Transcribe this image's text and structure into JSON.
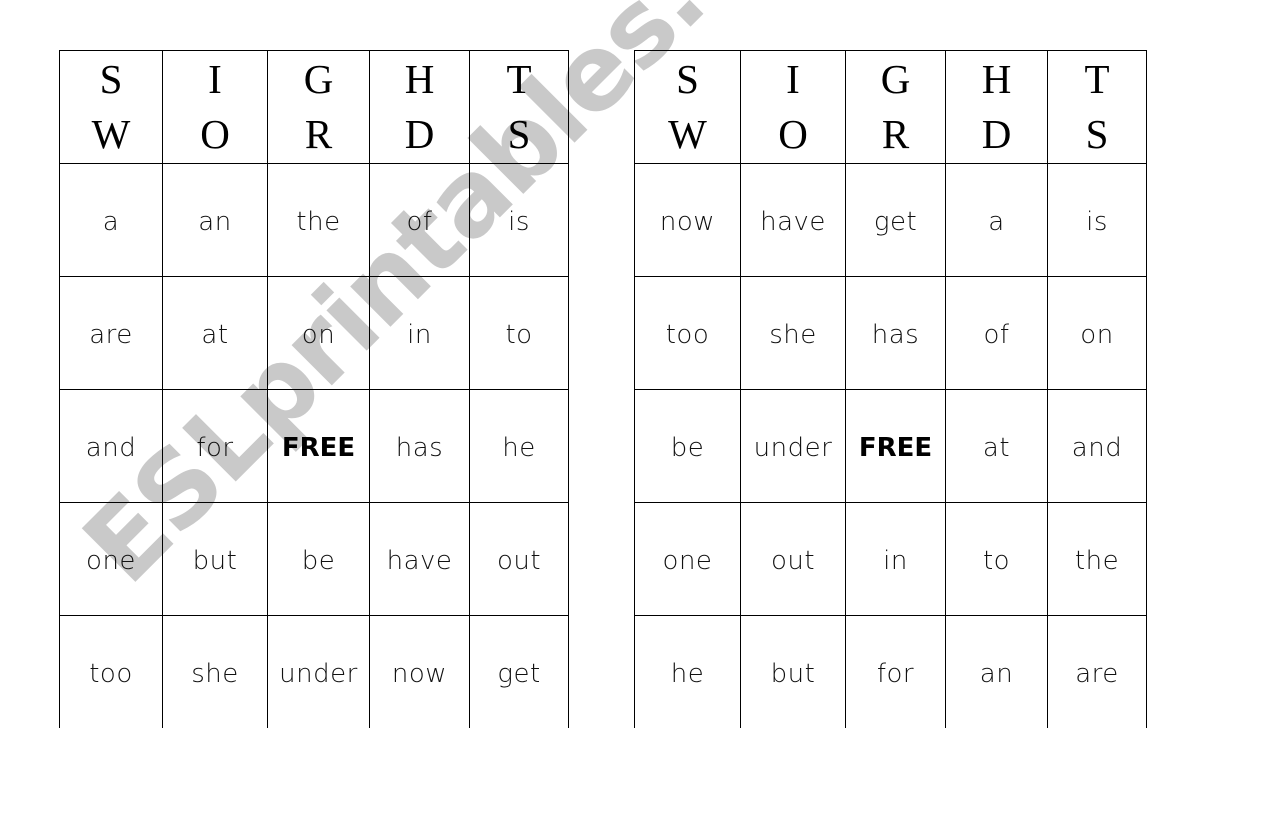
{
  "watermark": "ESLprintables.com",
  "header": {
    "top": [
      "S",
      "I",
      "G",
      "H",
      "T"
    ],
    "bottom": [
      "W",
      "O",
      "R",
      "D",
      "S"
    ]
  },
  "boards": [
    {
      "rows": [
        [
          "a",
          "an",
          "the",
          "of",
          "is"
        ],
        [
          "are",
          "at",
          "on",
          "in",
          "to"
        ],
        [
          "and",
          "for",
          "FREE",
          "has",
          "he"
        ],
        [
          "one",
          "but",
          "be",
          "have",
          "out"
        ],
        [
          "too",
          "she",
          "under",
          "now",
          "get"
        ]
      ]
    },
    {
      "rows": [
        [
          "now",
          "have",
          "get",
          "a",
          "is"
        ],
        [
          "too",
          "she",
          "has",
          "of",
          "on"
        ],
        [
          "be",
          "under",
          "FREE",
          "at",
          "and"
        ],
        [
          "one",
          "out",
          "in",
          "to",
          "the"
        ],
        [
          "he",
          "but",
          "for",
          "an",
          "are"
        ]
      ]
    }
  ],
  "free_label": "FREE",
  "colors": {
    "grid": "#000000",
    "text": "#111111",
    "watermark": "#c9c9c9"
  }
}
